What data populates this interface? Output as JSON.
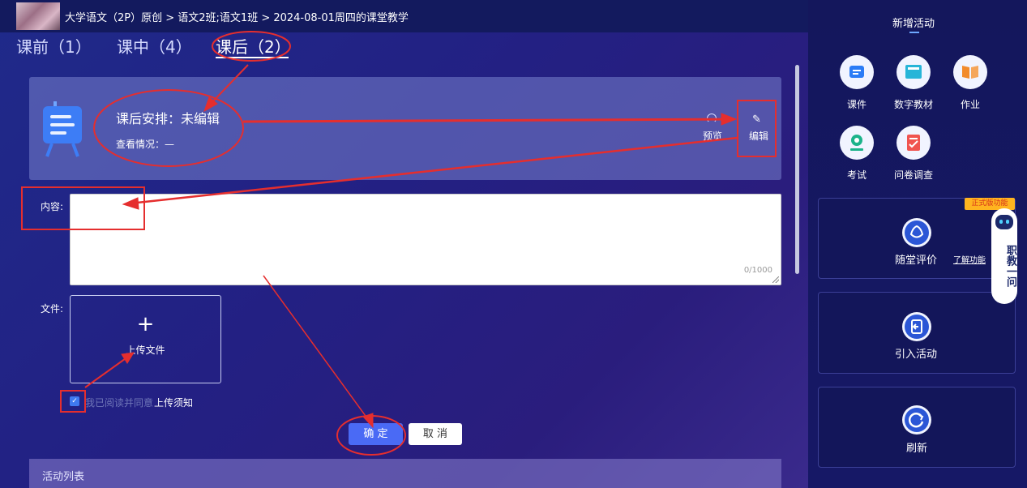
{
  "header": {
    "breadcrumb": "大学语文（2P）原创 > 语文2班;语文1班 > 2024-08-01周四的课堂教学"
  },
  "tabs": [
    {
      "label": "课前（1）"
    },
    {
      "label": "课中（4）"
    },
    {
      "label": "课后（2）"
    }
  ],
  "card": {
    "title": "课后安排：未编辑",
    "status": "查看情况：—",
    "preview_label": "预览",
    "edit_label": "编辑"
  },
  "form": {
    "content_label": "内容:",
    "content_value": "",
    "counter": "0/1000",
    "file_label": "文件:",
    "upload_plus": "+",
    "upload_label": "上传文件",
    "agree_text": "我已阅读并同意",
    "notice_link": "上传须知",
    "confirm_label": "确 定",
    "cancel_label": "取 消"
  },
  "activity_list_label": "活动列表",
  "sidebar": {
    "title": "新增活动",
    "activities": [
      {
        "label": "课件",
        "icon": "courseware-icon",
        "color": "#2b7cf6"
      },
      {
        "label": "数字教材",
        "icon": "digital-textbook-icon",
        "color": "#27b5d8"
      },
      {
        "label": "作业",
        "icon": "homework-book-icon",
        "color": "#f28b2b"
      },
      {
        "label": "考试",
        "icon": "exam-icon",
        "color": "#1bb38a"
      },
      {
        "label": "问卷调查",
        "icon": "survey-icon",
        "color": "#f0544f"
      }
    ],
    "panels": [
      {
        "label": "随堂评价",
        "icon": "flower-icon",
        "extra": "了解功能"
      },
      {
        "label": "引入活动",
        "icon": "import-icon"
      },
      {
        "label": "刷新",
        "icon": "refresh-icon"
      }
    ],
    "badge": "正式版功能",
    "assistant_label": "职教一问"
  }
}
